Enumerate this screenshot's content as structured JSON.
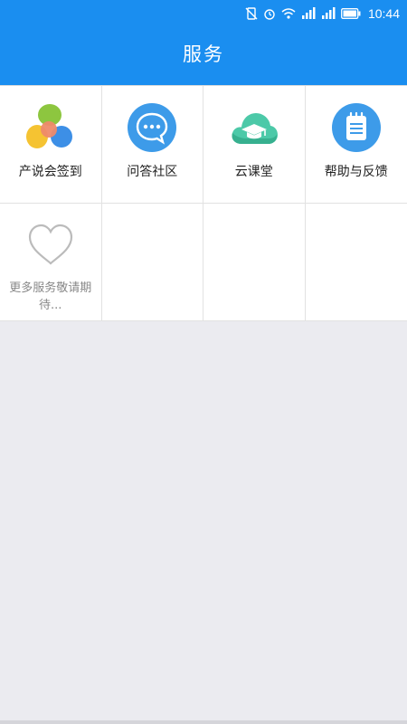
{
  "status_bar": {
    "time": "10:44",
    "icons": [
      "no-sim-icon",
      "alarm-icon",
      "wifi-icon",
      "signal-icon",
      "signal-icon",
      "battery-icon"
    ]
  },
  "header": {
    "title": "服务"
  },
  "services": [
    {
      "label": "产说会签到",
      "icon": "colorful-bubbles-icon"
    },
    {
      "label": "问答社区",
      "icon": "chat-bubble-icon"
    },
    {
      "label": "云课堂",
      "icon": "cloud-graduation-cap-icon"
    },
    {
      "label": "帮助与反馈",
      "icon": "notepad-icon"
    },
    {
      "label": "更多服务敬请期待...",
      "icon": "heart-outline-icon"
    }
  ],
  "colors": {
    "header_bg": "#1a8ef0",
    "page_bg": "#ebebf0"
  }
}
